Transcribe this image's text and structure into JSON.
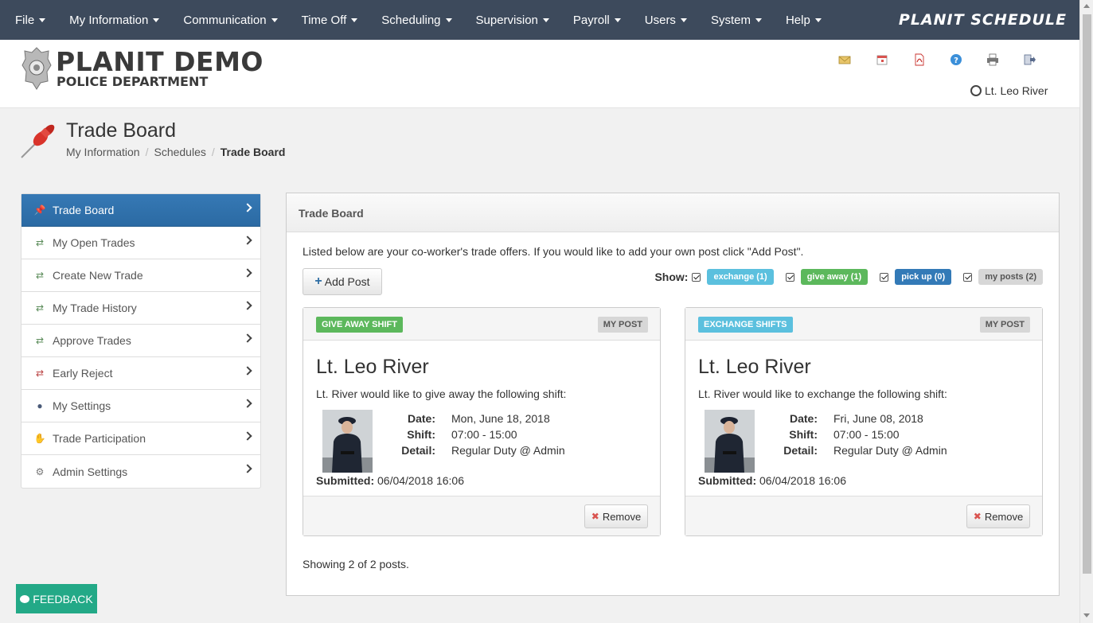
{
  "nav": {
    "items": [
      {
        "label": "File"
      },
      {
        "label": "My Information"
      },
      {
        "label": "Communication"
      },
      {
        "label": "Time Off"
      },
      {
        "label": "Scheduling"
      },
      {
        "label": "Supervision"
      },
      {
        "label": "Payroll"
      },
      {
        "label": "Users"
      },
      {
        "label": "System"
      },
      {
        "label": "Help"
      }
    ],
    "brand": "PLANIT SCHEDULE"
  },
  "header": {
    "org_name": "PLANIT DEMO",
    "org_sub": "POLICE DEPARTMENT",
    "icons": [
      "mail-icon",
      "calendar-icon",
      "pdf-icon",
      "help-icon",
      "print-icon",
      "logout-icon"
    ],
    "user": "Lt. Leo River"
  },
  "page": {
    "title": "Trade Board",
    "breadcrumb": [
      "My Information",
      "Schedules",
      "Trade Board"
    ]
  },
  "sidebar": {
    "items": [
      {
        "label": "Trade Board",
        "icon": "pushpin-icon",
        "active": true
      },
      {
        "label": "My Open Trades",
        "icon": "trade-icon"
      },
      {
        "label": "Create New Trade",
        "icon": "trade-icon"
      },
      {
        "label": "My Trade History",
        "icon": "trade-icon"
      },
      {
        "label": "Approve Trades",
        "icon": "trade-icon"
      },
      {
        "label": "Early Reject",
        "icon": "trade-reject-icon"
      },
      {
        "label": "My Settings",
        "icon": "user-icon"
      },
      {
        "label": "Trade Participation",
        "icon": "handshake-icon"
      },
      {
        "label": "Admin Settings",
        "icon": "gear-icon"
      }
    ]
  },
  "panel": {
    "title": "Trade Board",
    "intro": "Listed below are your co-worker's trade offers. If you would like to add your own post click \"Add Post\".",
    "add_post": "Add Post",
    "show_label": "Show:",
    "filters": [
      {
        "label": "exchange (1)",
        "color": "#5bc0de",
        "text_color": "#ffffff",
        "checked": true
      },
      {
        "label": "give away (1)",
        "color": "#5cb85c",
        "text_color": "#ffffff",
        "checked": true
      },
      {
        "label": "pick up (0)",
        "color": "#337ab7",
        "text_color": "#ffffff",
        "checked": true
      },
      {
        "label": "my posts (2)",
        "color": "#d7d7d7",
        "text_color": "#555555",
        "checked": true
      }
    ],
    "cards": [
      {
        "tag": "GIVE AWAY SHIFT",
        "tag_color": "#5cb85c",
        "mine": "MY POST",
        "name": "Lt. Leo River",
        "desc": "Lt. River would like to give away the following shift:",
        "date_label": "Date:",
        "date": "Mon, June 18, 2018",
        "shift_label": "Shift:",
        "shift": "07:00 - 15:00",
        "detail_label": "Detail:",
        "detail": "Regular Duty @ Admin",
        "submitted_label": "Submitted:",
        "submitted": "06/04/2018 16:06",
        "remove": "Remove"
      },
      {
        "tag": "EXCHANGE SHIFTS",
        "tag_color": "#5bc0de",
        "mine": "MY POST",
        "name": "Lt. Leo River",
        "desc": "Lt. River would like to exchange the following shift:",
        "date_label": "Date:",
        "date": "Fri, June 08, 2018",
        "shift_label": "Shift:",
        "shift": "07:00 - 15:00",
        "detail_label": "Detail:",
        "detail": "Regular Duty @ Admin",
        "submitted_label": "Submitted:",
        "submitted": "06/04/2018 16:06",
        "remove": "Remove"
      }
    ],
    "showing": "Showing 2 of 2 posts."
  },
  "feedback": "FEEDBACK"
}
